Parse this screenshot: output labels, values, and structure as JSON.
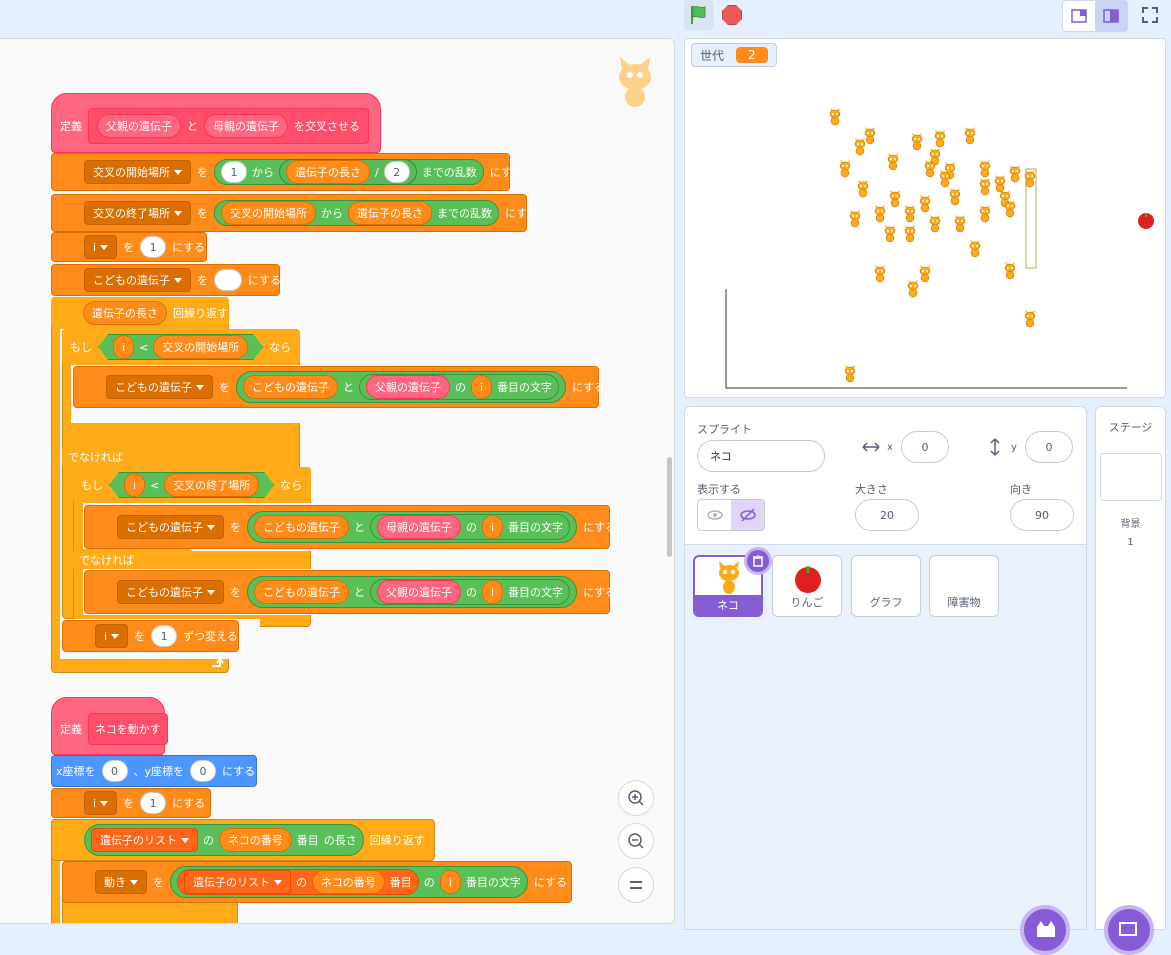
{
  "code": {
    "def1": {
      "label": "定義",
      "param1": "父親の遺伝子",
      "and": "と",
      "param2": "母親の遺伝子",
      "suffix": "を交叉させる"
    },
    "set_start": {
      "var": "交叉の開始場所",
      "to": "を",
      "from_num": "1",
      "kara": "から",
      "len": "遺伝子の長さ",
      "div": "/",
      "div_num": "2",
      "suffix": "までの乱数",
      "end": "にする"
    },
    "set_end": {
      "var": "交叉の終了場所",
      "to": "を",
      "from_var": "交叉の開始場所",
      "kara": "から",
      "len": "遺伝子の長さ",
      "suffix": "までの乱数",
      "end": "にする"
    },
    "set_i": {
      "var": "i",
      "to": "を",
      "num": "1",
      "end": "にする"
    },
    "set_child": {
      "var": "こどもの遺伝子",
      "to": "を",
      "num": "",
      "end": "にする"
    },
    "repeat": {
      "len": "遺伝子の長さ",
      "label": "回繰り返す"
    },
    "if1": {
      "label": "もし",
      "i": "i",
      "lt": "<",
      "var": "交叉の開始場所",
      "then": "なら"
    },
    "set_child_a": {
      "var": "こどもの遺伝子",
      "to": "を",
      "v1": "こどもの遺伝子",
      "and": "と",
      "v2": "父親の遺伝子",
      "no": "の",
      "i": "i",
      "idx": "番目の文字",
      "end": "にする"
    },
    "else1": "でなければ",
    "if2": {
      "label": "もし",
      "i": "i",
      "lt": "<",
      "var": "交叉の終了場所",
      "then": "なら"
    },
    "set_child_b": {
      "var": "こどもの遺伝子",
      "to": "を",
      "v1": "こどもの遺伝子",
      "and": "と",
      "v2": "母親の遺伝子",
      "no": "の",
      "i": "i",
      "idx": "番目の文字",
      "end": "にする"
    },
    "else2": "でなければ",
    "set_child_c": {
      "var": "こどもの遺伝子",
      "to": "を",
      "v1": "こどもの遺伝子",
      "and": "と",
      "v2": "父親の遺伝子",
      "no": "の",
      "i": "i",
      "idx": "番目の文字",
      "end": "にする"
    },
    "change_i": {
      "var": "i",
      "to": "を",
      "num": "1",
      "end": "ずつ変える"
    },
    "def2": {
      "label": "定義",
      "name": "ネコを動かす"
    },
    "goto": {
      "x_label": "x座標を",
      "x": "0",
      "y_label": "、y座標を",
      "y": "0",
      "end": "にする"
    },
    "set_i2": {
      "var": "i",
      "to": "を",
      "num": "1",
      "end": "にする"
    },
    "repeat2": {
      "list": "遺伝子のリスト",
      "no": "の",
      "idx_var": "ネコの番号",
      "item": "番目",
      "len": "の長さ",
      "label": "回繰り返す"
    },
    "set_move": {
      "var": "動き",
      "to": "を",
      "list": "遺伝子のリスト",
      "no": "の",
      "idx_var": "ネコの番号",
      "item": "番目",
      "no2": "の",
      "i": "i",
      "idx": "番目の文字",
      "end": "にする"
    }
  },
  "stage": {
    "monitor_label": "世代",
    "monitor_value": "2"
  },
  "sprite_info": {
    "sprite_label": "スプライト",
    "sprite_name": "ネコ",
    "x_label": "x",
    "x": "0",
    "y_label": "y",
    "y": "0",
    "show_label": "表示する",
    "size_label": "大きさ",
    "size": "20",
    "direction_label": "向き",
    "direction": "90"
  },
  "sprites": [
    {
      "name": "ネコ"
    },
    {
      "name": "りんご"
    },
    {
      "name": "グラフ"
    },
    {
      "name": "障害物"
    }
  ],
  "stage_pane": {
    "title": "ステージ",
    "backdrop_label": "背景",
    "backdrop_count": "1"
  },
  "colors": {
    "control": "#ffab19",
    "variables": "#ff8c1a",
    "operators": "#59c059",
    "my_blocks": "#ff6680",
    "motion": "#4c97ff",
    "accent": "#855cd6"
  }
}
